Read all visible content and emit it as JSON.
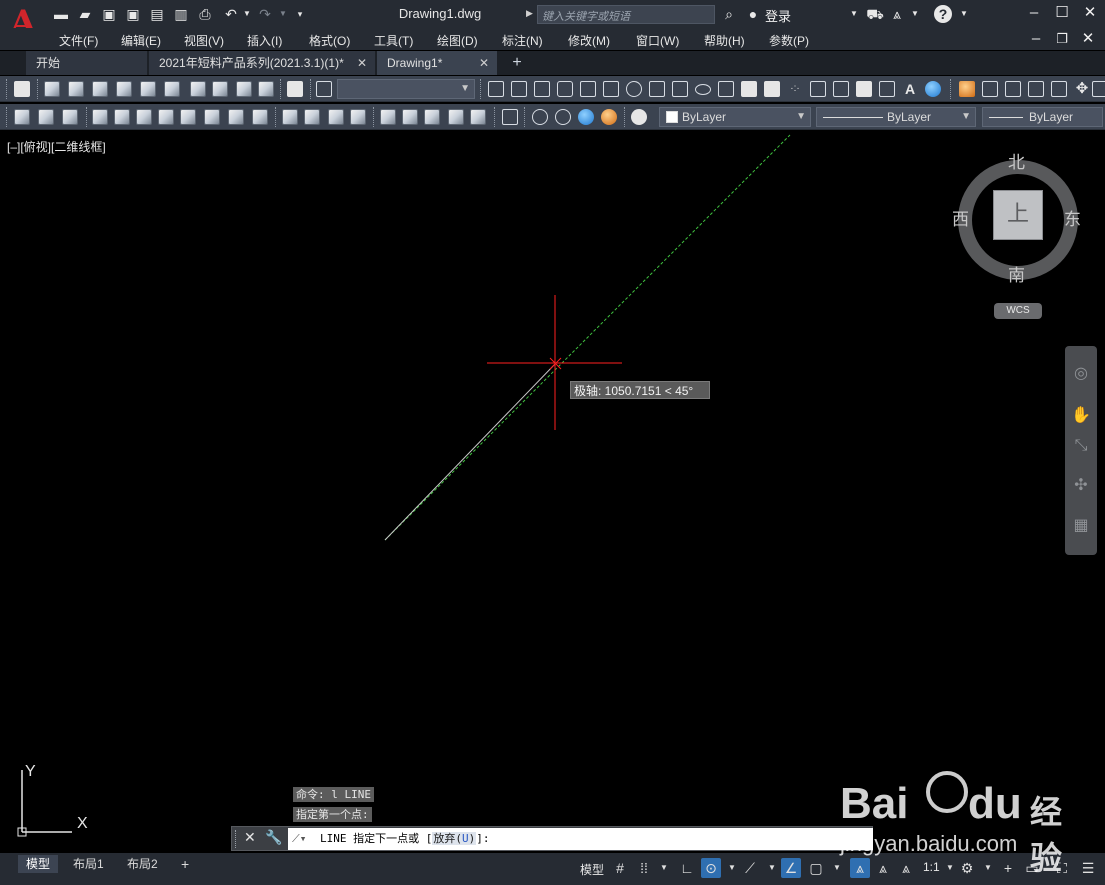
{
  "app": {
    "logo_letter": "A",
    "window_title": "Drawing1.dwg",
    "search_placeholder": "键入关键字或短语",
    "login": "登录"
  },
  "menu": [
    "文件(F)",
    "编辑(E)",
    "视图(V)",
    "插入(I)",
    "格式(O)",
    "工具(T)",
    "绘图(D)",
    "标注(N)",
    "修改(M)",
    "窗口(W)",
    "帮助(H)",
    "参数(P)"
  ],
  "file_tabs": [
    {
      "label": "开始",
      "closable": false,
      "active": false
    },
    {
      "label": "2021年短料产品系列(2021.3.1)(1)*",
      "closable": true,
      "active": false
    },
    {
      "label": "Drawing1*",
      "closable": true,
      "active": true
    }
  ],
  "toolbar2": {
    "color_combo": "ByLayer",
    "linetype_combo": "ByLayer",
    "lineweight_combo": "ByLayer"
  },
  "viewport": {
    "label": "[–][俯视][二维线框]",
    "tooltip": "极轴: 1050.7151 < 45°"
  },
  "viewcube": {
    "north": "北",
    "south": "南",
    "east": "东",
    "west": "西",
    "face": "上",
    "wcs": "WCS"
  },
  "ucs": {
    "x": "X",
    "y": "Y"
  },
  "command": {
    "history": [
      "命令: l LINE",
      "指定第一个点:"
    ],
    "prompt_prefix": "LINE 指定下一点或 [",
    "option": "放弃(",
    "option_key": "U",
    "option_end": ")",
    "prompt_suffix": "]:"
  },
  "status": {
    "layout_tabs": [
      "模型",
      "布局1",
      "布局2"
    ],
    "model_label": "模型",
    "scale": "1:1"
  },
  "colors": {
    "title_bg": "#262b33",
    "toolbar_bg": "#3b4350",
    "crosshair": "#ff2020",
    "polar_track": "#3fbf3f",
    "accent": "#2f6fb1"
  },
  "watermark": {
    "brand": "Bai",
    "brand2": "du",
    "cn": "经验",
    "url": "jingyan.baidu.com"
  }
}
